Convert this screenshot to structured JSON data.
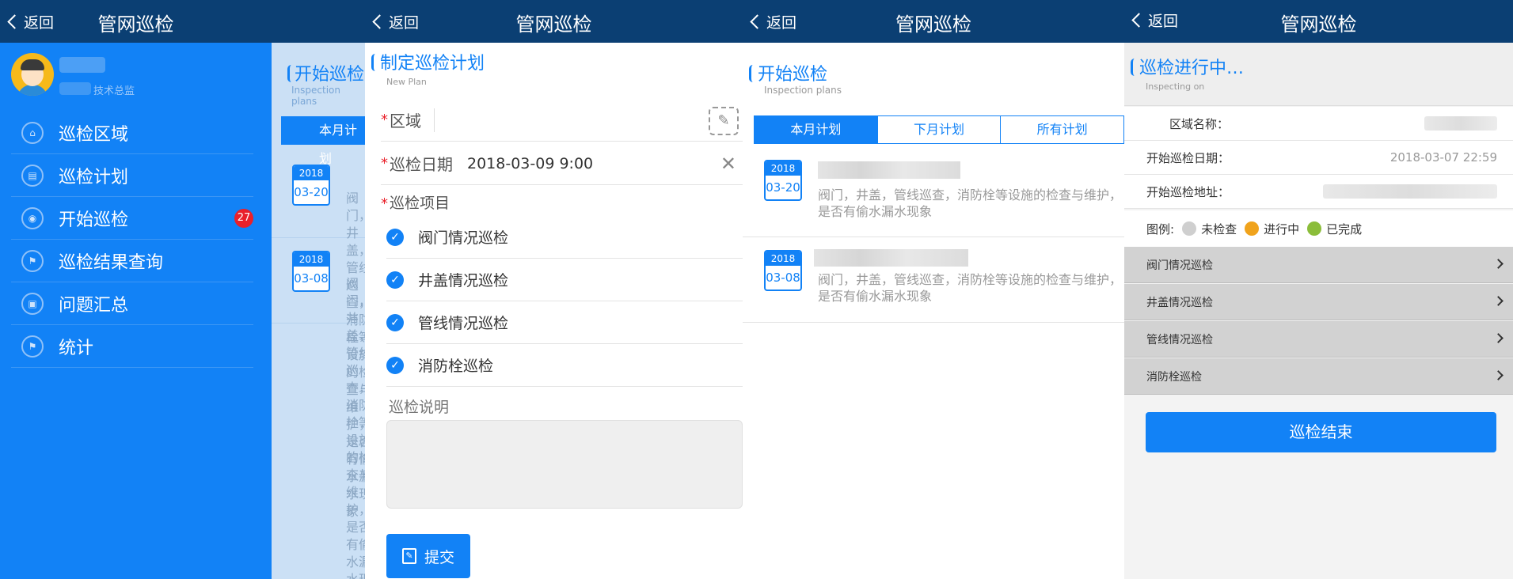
{
  "common": {
    "back_label": "返回",
    "title": "管网巡检"
  },
  "panel1": {
    "role": "技术总监",
    "badge_count": "27",
    "menu": [
      {
        "label": "巡检区域",
        "icon": "home-icon"
      },
      {
        "label": "巡检计划",
        "icon": "book-icon"
      },
      {
        "label": "开始巡检",
        "icon": "eye-icon"
      },
      {
        "label": "巡检结果查询",
        "icon": "flag-icon"
      },
      {
        "label": "问题汇总",
        "icon": "document-icon"
      },
      {
        "label": "统计",
        "icon": "flag-icon"
      }
    ],
    "bg_title": "开始巡检",
    "bg_subtitle": "Inspection plans",
    "bg_tab": "本月计划",
    "bg_rows": [
      {
        "year": "2018",
        "date": "03-20",
        "text": "阀门，井盖，管线巡查，消防栓等设施的检查与维护，是否有偷水漏水现象"
      },
      {
        "year": "2018",
        "date": "03-08",
        "text": "阀门，井盖，管线巡查，消防栓等设施的检查与维护，是否有偷水漏水现象"
      }
    ]
  },
  "panel2": {
    "header_title": "制定巡检计划",
    "header_subtitle": "New Plan",
    "region_label": "区域",
    "region_value": "",
    "date_label": "巡检日期",
    "date_value": "2018-03-09  9:00",
    "items_label": "巡检项目",
    "items": [
      "阀门情况巡检",
      "井盖情况巡检",
      "管线情况巡检",
      "消防栓巡检"
    ],
    "desc_label": "巡检说明",
    "desc_value": "",
    "submit_label": "提交"
  },
  "panel3": {
    "header_title": "开始巡检",
    "header_subtitle": "Inspection plans",
    "tabs": [
      "本月计划",
      "下月计划",
      "所有计划"
    ],
    "active_tab": 0,
    "rows": [
      {
        "year": "2018",
        "date": "03-20",
        "text": "阀门，井盖，管线巡查，消防栓等设施的检查与维护，是否有偷水漏水现象"
      },
      {
        "year": "2018",
        "date": "03-08",
        "text": "阀门，井盖，管线巡查，消防栓等设施的检查与维护，是否有偷水漏水现象"
      }
    ]
  },
  "panel4": {
    "header_title": "巡检进行中…",
    "header_subtitle": "Inspecting on",
    "area_name_label": "区域名称：",
    "start_date_label": "开始巡检日期：",
    "start_date_value": "2018-03-07 22:59",
    "start_address_label": "开始巡检地址：",
    "legend_label": "图例:",
    "legend": [
      {
        "label": "未检查",
        "color": "#cfcfcf"
      },
      {
        "label": "进行中",
        "color": "#f0a31c"
      },
      {
        "label": "已完成",
        "color": "#8bbd3a"
      }
    ],
    "items": [
      "阀门情况巡检",
      "井盖情况巡检",
      "管线情况巡检",
      "消防栓巡检"
    ],
    "end_button_label": "巡检结束"
  },
  "colors": {
    "primary": "#1282f6",
    "topbar": "#0b3f73",
    "badge": "#e9202a"
  }
}
